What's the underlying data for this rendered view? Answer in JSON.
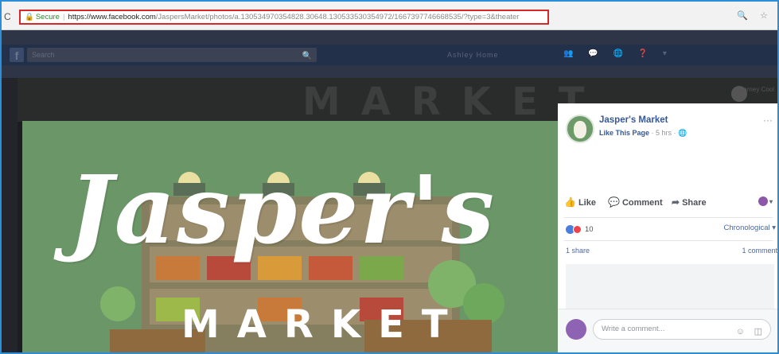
{
  "browser": {
    "reload_glyph": "C",
    "lock_glyph": "🔒",
    "secure_label": "Secure",
    "url_domain": "https://www.facebook.com",
    "url_path": "/JaspersMarket/photos/a.130534970354828.30648.130533530354972/1667397746668535/?type=3&theater",
    "icons": "🔍 ☆"
  },
  "facebook_bar": {
    "logo": "f",
    "search_placeholder": "Search",
    "nav_text": "Ashley   Home",
    "nav_icons": "👥 💬 🌐 ❓ ▾"
  },
  "banner": {
    "market_text": "MARKET",
    "user_text": "Barney Cool"
  },
  "photo": {
    "title": "Jasper's",
    "subtitle": "MARKET"
  },
  "post": {
    "page_name": "Jasper's Market",
    "like_page": "Like This Page",
    "meta": " · 5 hrs · 🌐",
    "more": "···"
  },
  "actions": {
    "like": "Like",
    "comment": "Comment",
    "share": "Share",
    "like_glyph": "👍",
    "comment_glyph": "💬",
    "share_glyph": "➦",
    "react_caret": "▾"
  },
  "stats": {
    "reaction_count": "10",
    "order": "Chronological ▾",
    "shares": "1 share",
    "comments": "1 comment"
  },
  "composer": {
    "placeholder": "Write a comment...",
    "emoji_glyph": "☺",
    "sticker_glyph": "◫"
  },
  "colors": {
    "photo_green": "#6b9668",
    "facebook_link": "#365899",
    "frame_border": "#2c8ed8",
    "url_highlight": "#d62828"
  }
}
